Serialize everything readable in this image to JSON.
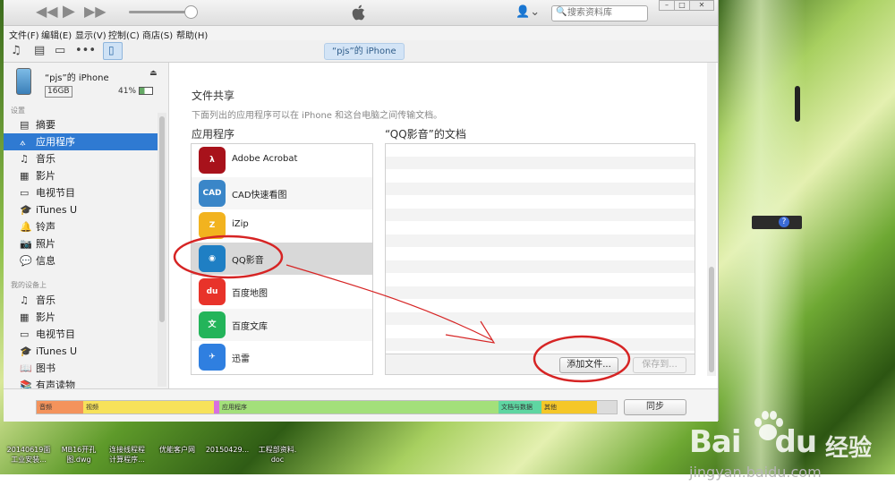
{
  "window": {
    "search_placeholder": "搜索资料库",
    "user_menu_caret": "⌄",
    "controls": [
      "–",
      "□",
      "✕"
    ]
  },
  "menu": [
    "文件(F)",
    "编辑(E)",
    "显示(V)",
    "控制(C)",
    "商店(S)",
    "帮助(H)"
  ],
  "toolbar": {
    "device_tab": "“pjs”的 iPhone",
    "more": "•••"
  },
  "device": {
    "name": "“pjs”的 iPhone",
    "capacity": "16GB",
    "battery": "41%"
  },
  "sidebar": {
    "settings_title": "设置",
    "settings_items": [
      {
        "label": "摘要",
        "icon": "summary-icon"
      },
      {
        "label": "应用程序",
        "icon": "apps-icon",
        "active": true
      },
      {
        "label": "音乐",
        "icon": "music-icon"
      },
      {
        "label": "影片",
        "icon": "movies-icon"
      },
      {
        "label": "电视节目",
        "icon": "tv-icon"
      },
      {
        "label": "iTunes U",
        "icon": "itunes-u-icon"
      },
      {
        "label": "铃声",
        "icon": "ringtone-icon"
      },
      {
        "label": "照片",
        "icon": "photo-icon"
      },
      {
        "label": "信息",
        "icon": "info-icon"
      }
    ],
    "device_title": "我的设备上",
    "device_items": [
      {
        "label": "音乐",
        "icon": "music-icon"
      },
      {
        "label": "影片",
        "icon": "movies-icon"
      },
      {
        "label": "电视节目",
        "icon": "tv-icon"
      },
      {
        "label": "iTunes U",
        "icon": "itunes-u-icon"
      },
      {
        "label": "图书",
        "icon": "books-icon"
      },
      {
        "label": "有声读物",
        "icon": "audiobook-icon"
      }
    ]
  },
  "file_sharing": {
    "title": "文件共享",
    "description": "下面列出的应用程序可以在 iPhone 和这台电脑之间传输文档。",
    "apps_heading": "应用程序",
    "docs_heading": "“QQ影音”的文档",
    "apps": [
      {
        "name": "Adobe Acrobat",
        "icon": "adobe-acrobat-icon",
        "color": "#a8121b",
        "glyph": "λ"
      },
      {
        "name": "CAD快速看图",
        "icon": "cad-viewer-icon",
        "color": "#3a86c8",
        "glyph": "CAD"
      },
      {
        "name": "iZip",
        "icon": "izip-icon",
        "color": "#f2b31f",
        "glyph": "Z"
      },
      {
        "name": "QQ影音",
        "icon": "qq-player-icon",
        "color": "#1f7fc4",
        "glyph": "◉",
        "selected": true
      },
      {
        "name": "百度地图",
        "icon": "baidu-map-icon",
        "color": "#e8332a",
        "glyph": "du"
      },
      {
        "name": "百度文库",
        "icon": "baidu-wenku-icon",
        "color": "#23b45a",
        "glyph": "文"
      },
      {
        "name": "迅雷",
        "icon": "xunlei-icon",
        "color": "#2f7fe0",
        "glyph": "✈"
      }
    ],
    "add_button": "添加文件...",
    "save_button": "保存到..."
  },
  "capacity_bar": [
    {
      "label": "音频",
      "color": "#f4935c"
    },
    {
      "label": "视频",
      "color": "#f7e25a"
    },
    {
      "label": "",
      "color": "#d86fe0"
    },
    {
      "label": "应用程序",
      "color": "#a3e07a"
    },
    {
      "label": "文档与数据",
      "color": "#5fd6a2"
    },
    {
      "label": "其他",
      "color": "#f5c728"
    },
    {
      "label": "",
      "color": "#dcdcdc"
    }
  ],
  "sync_button": "同步",
  "taskbar": [
    {
      "line1": "20140619面",
      "line2": "工业安装..."
    },
    {
      "line1": "MB16开孔",
      "line2": "图.dwg"
    },
    {
      "line1": "连接线程程",
      "line2": "计算程序..."
    },
    {
      "line1": "优能客户网",
      "line2": ""
    },
    {
      "line1": "20150429...",
      "line2": ""
    },
    {
      "line1": "工程部资料.",
      "line2": "doc"
    }
  ],
  "watermark": {
    "brand": "Bai",
    "brand_suffix": "du",
    "product": "经验",
    "url": "jingyan.baidu.com"
  },
  "colors": {
    "accent": "#2f7ad2",
    "annotation": "#d62424"
  }
}
